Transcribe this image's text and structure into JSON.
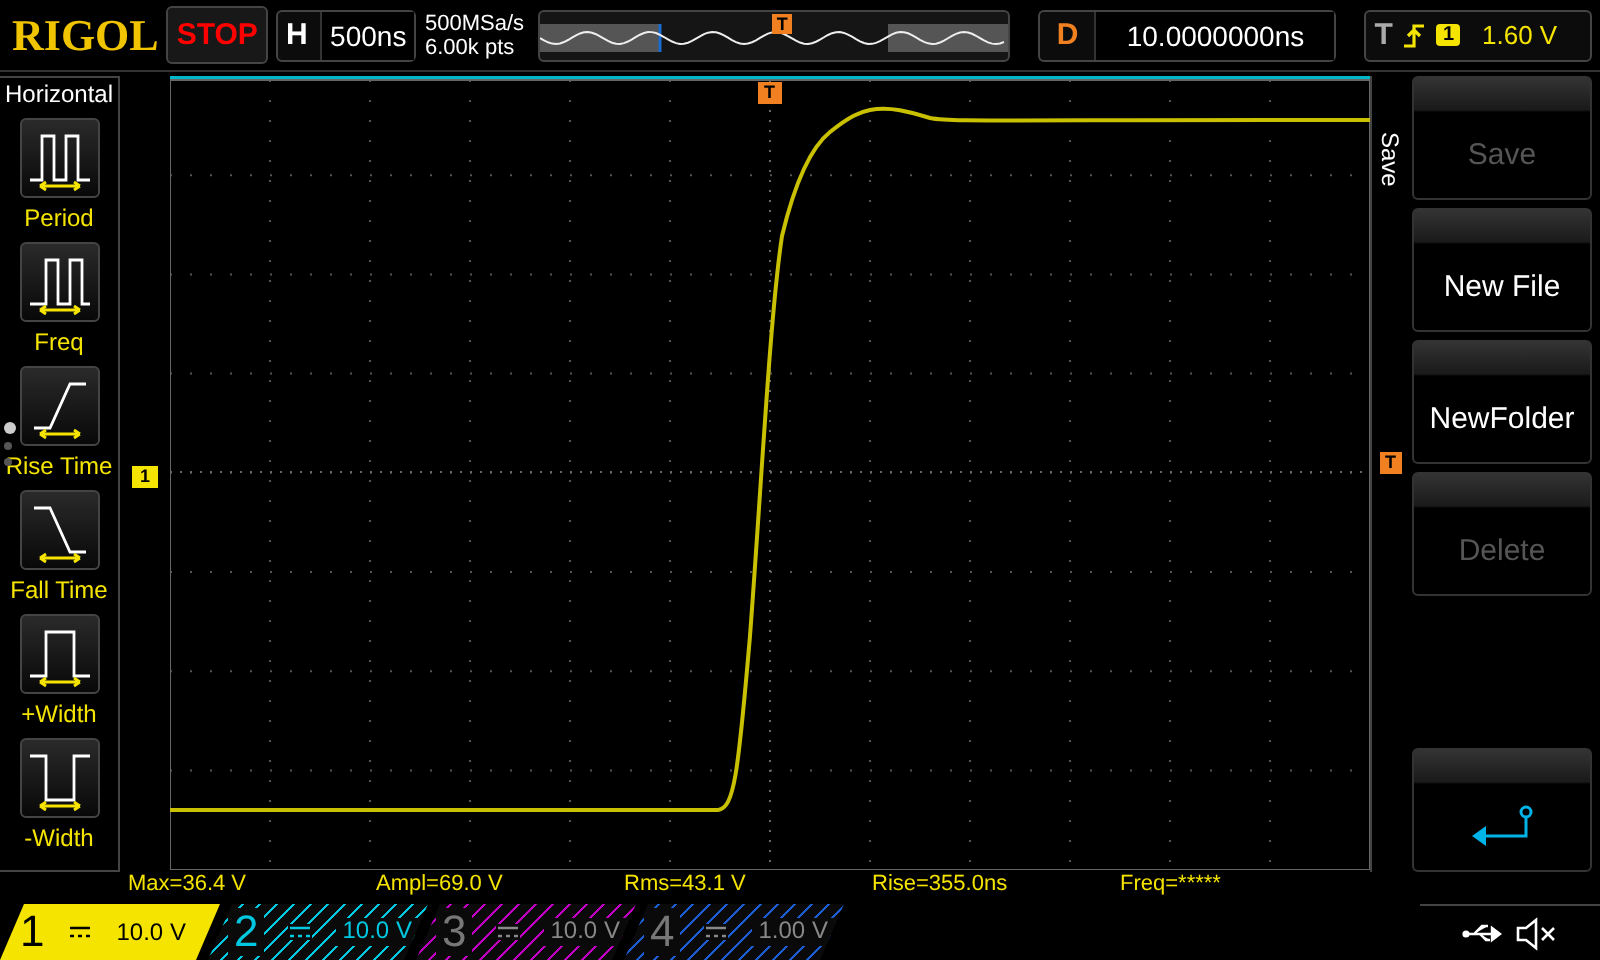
{
  "header": {
    "logo": "RIGOL",
    "run_state": "STOP",
    "timebase": {
      "label": "H",
      "value": "500ns"
    },
    "sample_rate": "500MSa/s",
    "memory_depth": "6.00k pts",
    "overview_marker": "T",
    "delay": {
      "label": "D",
      "value": "10.0000000ns"
    },
    "trigger": {
      "label": "T",
      "channel": "1",
      "level": "1.60 V"
    }
  },
  "measure_menu": {
    "title": "Horizontal",
    "pages": [
      {
        "selected": true
      },
      {
        "selected": false
      },
      {
        "selected": false
      }
    ],
    "items": [
      {
        "label": "Period",
        "kind": "period"
      },
      {
        "label": "Freq",
        "kind": "freq"
      },
      {
        "label": "Rise Time",
        "kind": "rise"
      },
      {
        "label": "Fall Time",
        "kind": "fall"
      },
      {
        "label": "+Width",
        "kind": "pwidth"
      },
      {
        "label": "-Width",
        "kind": "nwidth"
      }
    ]
  },
  "markers": {
    "channel": "1",
    "trigger_level": "T",
    "trigger_position": "T"
  },
  "softkey_menu": {
    "title": "Save",
    "buttons": [
      {
        "kind": "text",
        "label": "Save",
        "disabled": true
      },
      {
        "kind": "text",
        "label": "New File",
        "disabled": false
      },
      {
        "kind": "text",
        "label": "NewFolder",
        "disabled": false
      },
      {
        "kind": "text",
        "label": "Delete",
        "disabled": true
      },
      {
        "kind": "back"
      }
    ]
  },
  "measurements": [
    "Max=36.4 V",
    "Ampl=69.0 V",
    "Rms=43.1 V",
    "Rise=355.0ns",
    "Freq=*****"
  ],
  "channels": [
    {
      "number": "1",
      "scale": "10.0 V",
      "selected": true,
      "on": true,
      "color": "#f5e400"
    },
    {
      "number": "2",
      "scale": "10.0 V",
      "selected": false,
      "on": true,
      "color": "#00c8e0"
    },
    {
      "number": "3",
      "scale": "10.0 V",
      "selected": false,
      "on": false,
      "color": "#c000c0"
    },
    {
      "number": "4",
      "scale": "1.00 V",
      "selected": false,
      "on": false,
      "color": "#1c5cd0"
    }
  ]
}
